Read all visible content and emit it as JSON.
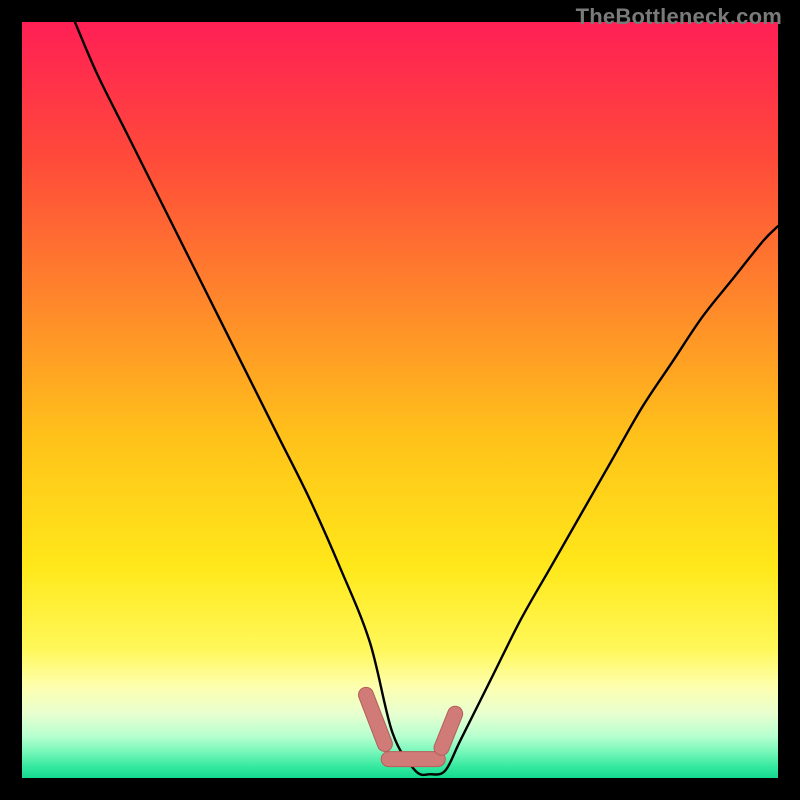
{
  "watermark": {
    "text": "TheBottleneck.com"
  },
  "colors": {
    "frame": "#000000",
    "gradient_stops": [
      {
        "offset": 0.0,
        "color": "#ff1f55"
      },
      {
        "offset": 0.18,
        "color": "#ff4a3a"
      },
      {
        "offset": 0.38,
        "color": "#ff8a2a"
      },
      {
        "offset": 0.55,
        "color": "#ffc21a"
      },
      {
        "offset": 0.72,
        "color": "#ffe81a"
      },
      {
        "offset": 0.83,
        "color": "#fff85a"
      },
      {
        "offset": 0.88,
        "color": "#fdffb0"
      },
      {
        "offset": 0.915,
        "color": "#e8ffd0"
      },
      {
        "offset": 0.945,
        "color": "#b6ffcf"
      },
      {
        "offset": 0.965,
        "color": "#78f7ba"
      },
      {
        "offset": 0.985,
        "color": "#35e9a0"
      },
      {
        "offset": 1.0,
        "color": "#14d98f"
      }
    ],
    "curve": "#000000",
    "marker_fill": "#d07b78",
    "marker_stroke": "#b65d5b"
  },
  "chart_data": {
    "type": "line",
    "title": "",
    "xlabel": "",
    "ylabel": "",
    "x_range": [
      0,
      100
    ],
    "y_range": [
      0,
      100
    ],
    "note": "y represents bottleneck mismatch (%) at a given x; curve troughs to ~0 near x≈49–56 and rises sharply on both sides.",
    "series": [
      {
        "name": "bottleneck-curve",
        "x": [
          7,
          10,
          14,
          18,
          22,
          26,
          30,
          34,
          38,
          42,
          46,
          49,
          52,
          54,
          56,
          58,
          62,
          66,
          70,
          74,
          78,
          82,
          86,
          90,
          94,
          98,
          100
        ],
        "y": [
          100,
          93,
          85,
          77,
          69,
          61,
          53,
          45,
          37,
          28,
          18,
          6,
          1,
          0.5,
          1,
          5,
          13,
          21,
          28,
          35,
          42,
          49,
          55,
          61,
          66,
          71,
          73
        ]
      }
    ],
    "markers": {
      "name": "trough-markers",
      "stroke_width": 14,
      "segments": [
        {
          "x1": 45.5,
          "y1": 11.0,
          "x2": 48.0,
          "y2": 4.5
        },
        {
          "x1": 48.5,
          "y1": 2.5,
          "x2": 55.0,
          "y2": 2.5
        },
        {
          "x1": 55.5,
          "y1": 4.0,
          "x2": 57.3,
          "y2": 8.5
        }
      ]
    }
  }
}
